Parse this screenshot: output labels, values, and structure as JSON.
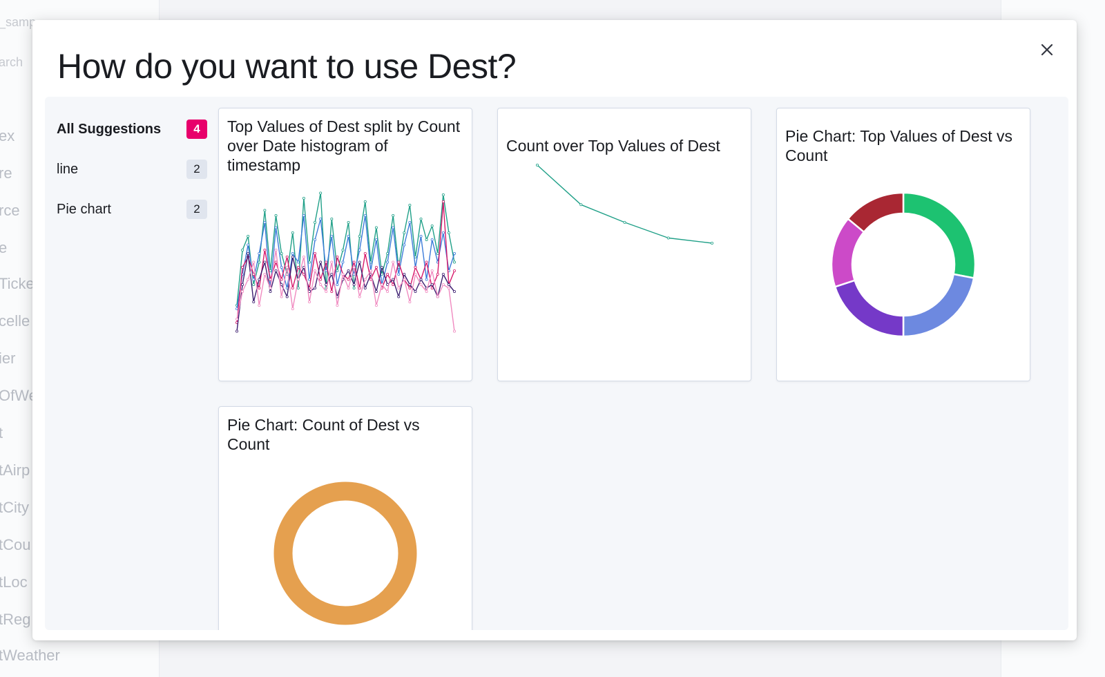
{
  "background": {
    "fields": [
      "_samp",
      "arch",
      "ex",
      "re",
      "rce",
      "e",
      "Ticke",
      "celle",
      "ier",
      "OfWe",
      "t",
      "tAirp",
      "tCity",
      "tCou",
      "tLoc",
      "tReg",
      "tWeather"
    ]
  },
  "modal": {
    "title": "How do you want to use Dest?",
    "close_icon": "close-icon",
    "filters": [
      {
        "label": "All Suggestions",
        "count": "4",
        "active": true
      },
      {
        "label": "line",
        "count": "2",
        "active": false
      },
      {
        "label": "Pie chart",
        "count": "2",
        "active": false
      }
    ],
    "cards": [
      {
        "title": "Top Values of Dest split by Count over Date histogram of timestamp"
      },
      {
        "title": "Count over Top Values of Dest"
      },
      {
        "title": "Pie Chart: Top Values of Dest vs Count"
      },
      {
        "title": "Pie Chart: Count of Dest vs Count"
      }
    ]
  },
  "chart_data": [
    {
      "type": "line",
      "x": [
        0,
        1,
        2,
        3,
        4,
        5,
        6,
        7,
        8,
        9,
        10,
        11,
        12,
        13,
        14,
        15,
        16,
        17,
        18,
        19,
        20,
        21,
        22,
        23,
        24,
        25,
        26,
        27,
        28,
        29,
        30,
        31,
        32,
        33,
        34,
        35,
        36,
        37,
        38,
        39
      ],
      "series": [
        {
          "color": "#20a088",
          "values": [
            30,
            62,
            70,
            42,
            55,
            85,
            50,
            82,
            60,
            48,
            72,
            40,
            92,
            55,
            78,
            95,
            40,
            80,
            50,
            62,
            78,
            40,
            70,
            90,
            55,
            75,
            48,
            60,
            82,
            52,
            72,
            88,
            58,
            80,
            68,
            76,
            60,
            94,
            72,
            55
          ]
        },
        {
          "color": "#3b7bd9",
          "values": [
            28,
            48,
            65,
            45,
            60,
            78,
            40,
            75,
            52,
            40,
            60,
            55,
            82,
            45,
            68,
            80,
            50,
            70,
            42,
            55,
            70,
            48,
            62,
            82,
            50,
            68,
            42,
            55,
            75,
            48,
            65,
            78,
            52,
            70,
            45,
            68,
            55,
            72,
            50,
            60
          ]
        },
        {
          "color": "#d6186a",
          "values": [
            20,
            52,
            58,
            48,
            40,
            62,
            45,
            55,
            45,
            58,
            40,
            52,
            48,
            40,
            60,
            45,
            55,
            38,
            58,
            48,
            45,
            55,
            40,
            60,
            45,
            52,
            40,
            48,
            42,
            55,
            45,
            40,
            52,
            45,
            55,
            40,
            48,
            90,
            42,
            50
          ]
        },
        {
          "color": "#3c1e70",
          "values": [
            15,
            42,
            60,
            32,
            45,
            55,
            38,
            50,
            42,
            35,
            58,
            45,
            52,
            38,
            40,
            55,
            42,
            48,
            35,
            45,
            50,
            42,
            55,
            40,
            48,
            38,
            52,
            42,
            45,
            35,
            48,
            42,
            38,
            45,
            40,
            42,
            35,
            48,
            42,
            38
          ]
        },
        {
          "color": "#f08ac0",
          "values": [
            22,
            38,
            45,
            55,
            30,
            48,
            40,
            62,
            35,
            52,
            28,
            45,
            58,
            32,
            50,
            42,
            38,
            55,
            30,
            48,
            40,
            52,
            35,
            45,
            50,
            30,
            42,
            38,
            55,
            40,
            45,
            32,
            48,
            42,
            38,
            50,
            35,
            42,
            40,
            15
          ]
        }
      ]
    },
    {
      "type": "line",
      "x": [
        0,
        1,
        2,
        3,
        4
      ],
      "series": [
        {
          "color": "#20a088",
          "values": [
            100,
            62,
            45,
            30,
            25
          ]
        }
      ]
    },
    {
      "type": "pie",
      "slices": [
        {
          "value": 28,
          "color": "#1dc271"
        },
        {
          "value": 22,
          "color": "#6d89e0"
        },
        {
          "value": 20,
          "color": "#7539c8"
        },
        {
          "value": 16,
          "color": "#cc4ac8"
        },
        {
          "value": 14,
          "color": "#a92733"
        }
      ]
    },
    {
      "type": "pie",
      "slices": [
        {
          "value": 100,
          "color": "#e5a04f"
        }
      ]
    }
  ]
}
